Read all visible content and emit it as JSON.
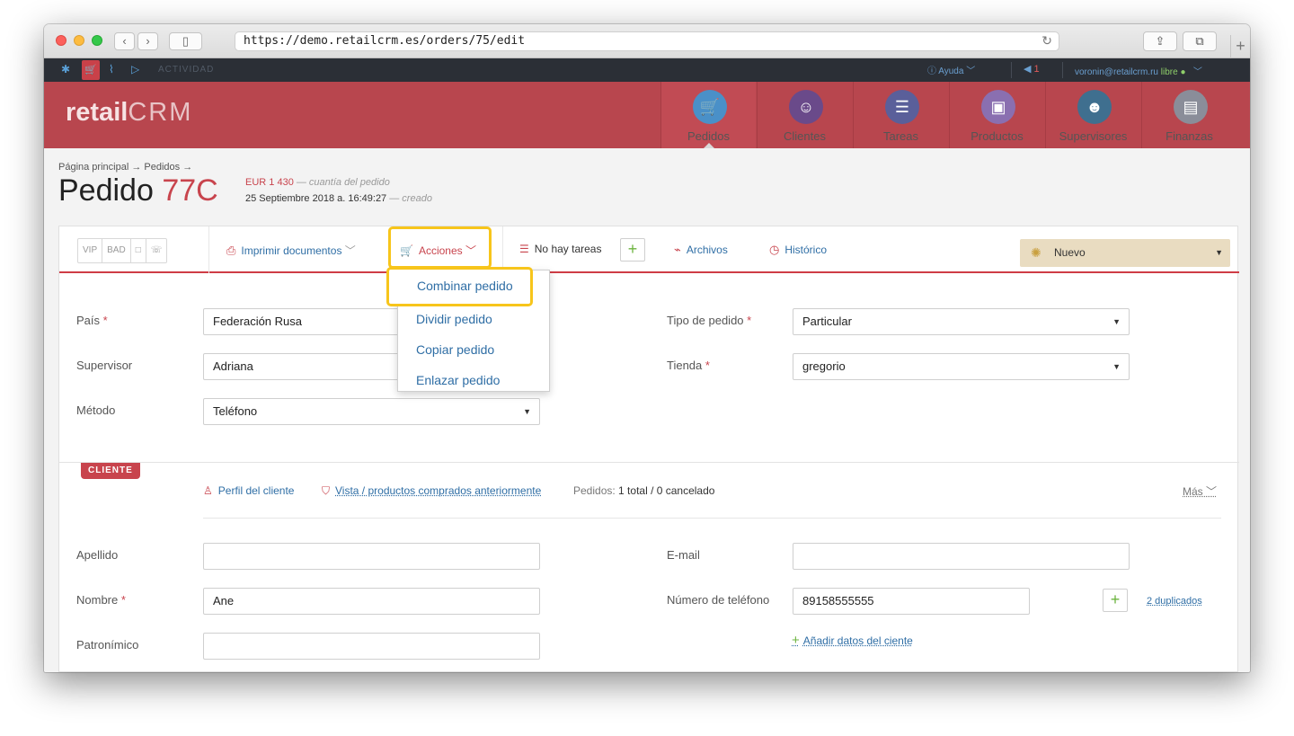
{
  "browser": {
    "url": "https://demo.retailcrm.es/orders/75/edit"
  },
  "topbar": {
    "activity_label": "ACTIVIDAD",
    "help_label": "Ayuda",
    "notifications_count": "1",
    "user_email": "voronin@retailcrm.ru",
    "user_status": "libre"
  },
  "header": {
    "logo_text": "retail",
    "logo_crm": "CRM",
    "nav": [
      {
        "label": "Pedidos",
        "icon": "cart-icon"
      },
      {
        "label": "Clientes",
        "icon": "user-icon"
      },
      {
        "label": "Tareas",
        "icon": "tasks-icon"
      },
      {
        "label": "Productos",
        "icon": "box-icon"
      },
      {
        "label": "Supervisores",
        "icon": "manager-icon"
      },
      {
        "label": "Finanzas",
        "icon": "finance-icon"
      }
    ]
  },
  "page": {
    "breadcrumb": "Página principal → Pedidos →",
    "title_prefix": "Pedido",
    "order_number": "77C",
    "amount": "EUR 1 430",
    "amount_note": "— cuantía del pedido",
    "created_date": "25 Septiembre 2018 a. 16:49:27",
    "created_note": "— creado"
  },
  "toolbar": {
    "tags": [
      "VIP",
      "BAD",
      "□",
      "☏"
    ],
    "print_label": "Imprimir documentos",
    "actions_label": "Acciones",
    "no_tasks_label": "No hay tareas",
    "files_label": "Archivos",
    "history_label": "Histórico",
    "status_value": "Nuevo",
    "status_colors": [
      "#d8d8d8",
      "#9fd07a",
      "#a9d6a9",
      "#9ecde0",
      "#9fb8e0",
      "#e0a9c5"
    ]
  },
  "actions_menu": {
    "items": [
      "Combinar pedido",
      "Dividir pedido",
      "Copiar pedido",
      "Enlazar pedido"
    ]
  },
  "order_form": {
    "country_label": "País",
    "country_value": "Federación Rusa",
    "supervisor_label": "Supervisor",
    "supervisor_value": "Adriana",
    "method_label": "Método",
    "method_value": "Teléfono",
    "order_type_label": "Tipo de pedido",
    "order_type_value": "Particular",
    "store_label": "Tienda",
    "store_value": "gregorio"
  },
  "client_section": {
    "badge": "CLIENTE",
    "profile_link": "Perfil del cliente",
    "purchases_link": "Vista / productos comprados anteriormente",
    "orders_label": "Pedidos:",
    "orders_value": "1 total / 0 cancelado",
    "more_label": "Más",
    "lastname_label": "Apellido",
    "lastname_value": "",
    "firstname_label": "Nombre",
    "firstname_value": "Ane",
    "patronymic_label": "Patronímico",
    "patronymic_value": "",
    "email_label": "E-mail",
    "email_value": "",
    "phone_label": "Número de teléfono",
    "phone_value": "89158555555",
    "duplicates_link": "2 duplicados",
    "add_data_link": "Añadir datos del ciente"
  }
}
